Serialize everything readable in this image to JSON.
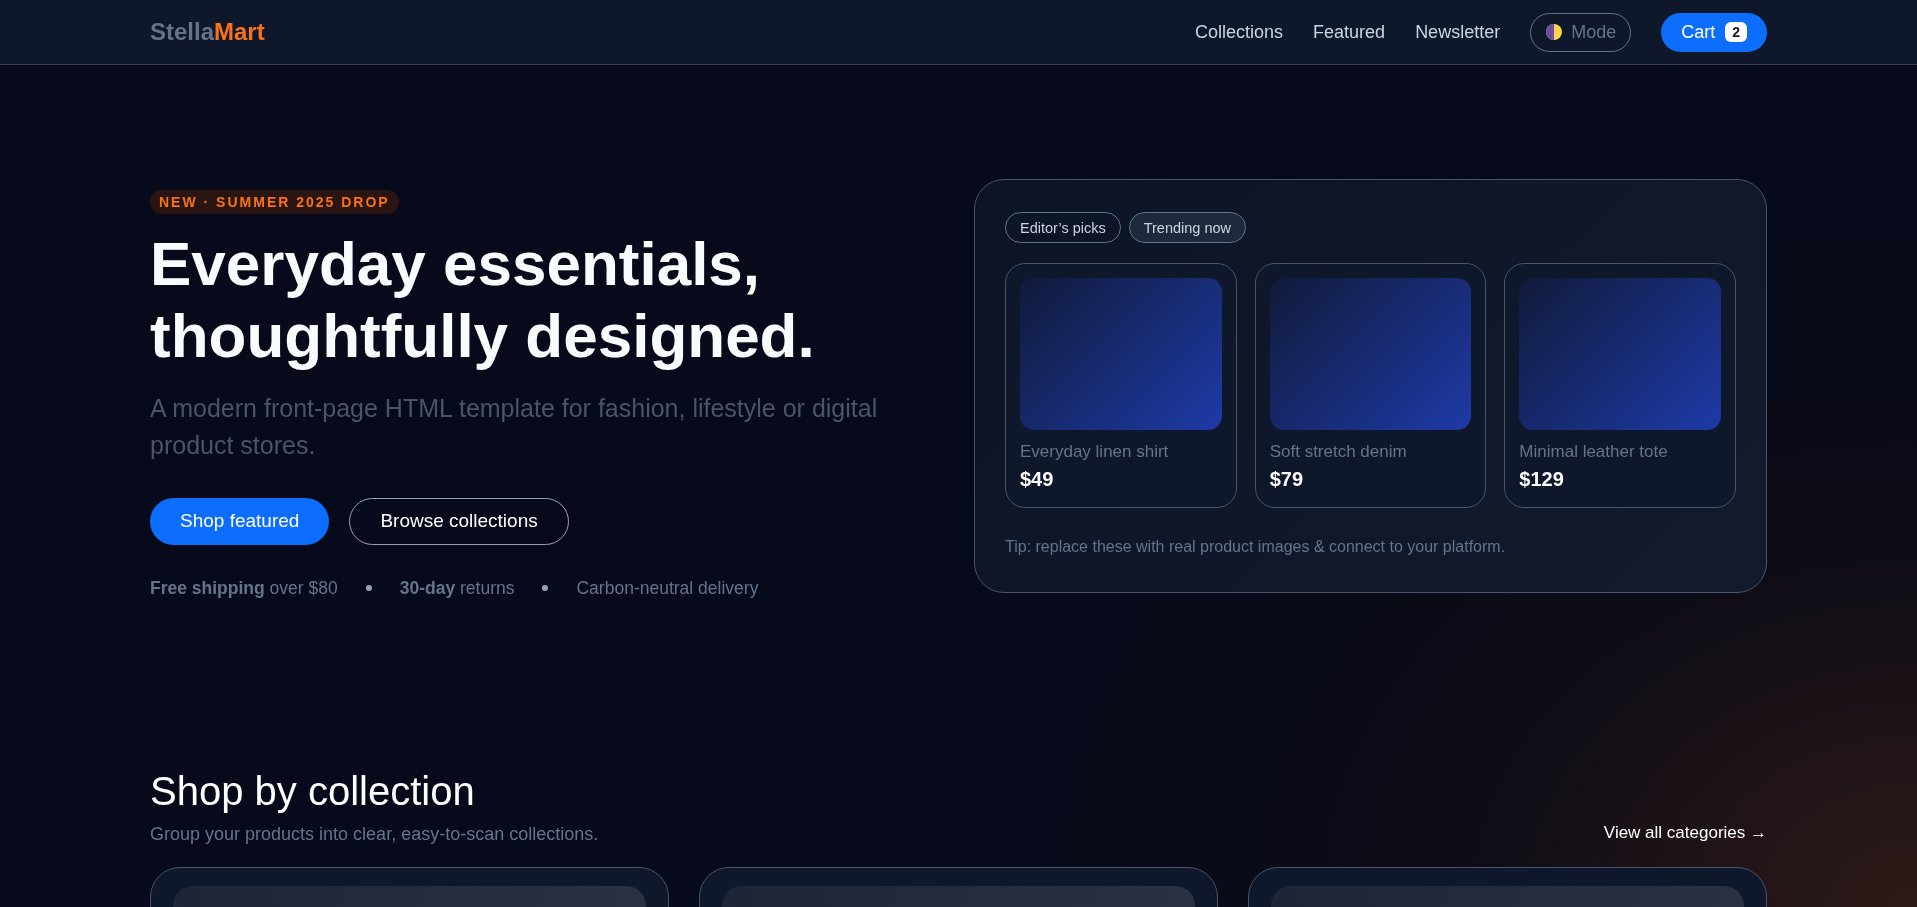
{
  "header": {
    "logo": [
      {
        "text": "Stella",
        "kind": "dark"
      },
      {
        "text": "Mart",
        "kind": "accent"
      }
    ],
    "nav": [
      "Collections",
      "Featured",
      "Newsletter"
    ],
    "mode_toggle": {
      "label": "Mode"
    },
    "cart": {
      "label": "Cart",
      "count": "2"
    }
  },
  "hero": {
    "badge": "NEW · SUMMER 2025 DROP",
    "title": "Everyday essentials, thoughtfully designed.",
    "subtitle": "A modern front-page HTML template for fashion, lifestyle or digital product stores.",
    "buttons": [
      {
        "label": "Shop featured",
        "kind": "primary"
      },
      {
        "label": "Browse collections",
        "kind": "secondary"
      }
    ],
    "perks": [
      "**Free shipping** over $80",
      "**30-day** returns",
      "Carbon-neutral delivery"
    ]
  },
  "showcase": {
    "tabs": [
      {
        "label": "Editor’s picks",
        "selected": false
      },
      {
        "label": "Trending now",
        "selected": true
      }
    ],
    "products": [
      {
        "name": "Everyday linen shirt",
        "price": "$49"
      },
      {
        "name": "Soft stretch denim",
        "price": "$79"
      },
      {
        "name": "Minimal leather tote",
        "price": "$129"
      }
    ],
    "tip": "Tip: replace these with real product images & connect to your platform."
  },
  "collections": {
    "title": "Shop by collection",
    "subtitle": "Group your products into clear, easy-to-scan collections.",
    "link": "View all categories →",
    "cards": [
      {
        "kind": "placeholder"
      },
      {
        "kind": "placeholder"
      },
      {
        "kind": "placeholder"
      }
    ]
  }
}
